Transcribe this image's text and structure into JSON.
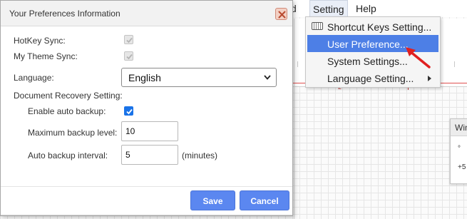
{
  "background_app": {
    "menubar": {
      "partial_item": "d",
      "setting_menu": "Setting",
      "help_menu": "Help"
    },
    "ruler_mark": "2",
    "setting_dropdown": {
      "items": [
        {
          "label": "Shortcut Keys Setting...",
          "icon": "keyboard-icon"
        },
        {
          "label": "User Preference...",
          "selected": true
        },
        {
          "label": "System Settings..."
        },
        {
          "label": "Language Setting...",
          "submenu": true
        }
      ]
    },
    "floating_panel": {
      "title": "Win",
      "icon_labels": [
        "°",
        "+5"
      ]
    },
    "annotation_color": "#e02020"
  },
  "dialog": {
    "title": "Your Preferences Information",
    "hotkey_sync": {
      "label": "HotKey Sync:",
      "checked": true,
      "disabled": true
    },
    "theme_sync": {
      "label": "My Theme Sync:",
      "checked": true,
      "disabled": true
    },
    "language": {
      "label": "Language:",
      "value": "English"
    },
    "recovery": {
      "section_label": "Document Recovery Setting:",
      "auto_backup": {
        "label": "Enable auto backup:",
        "checked": true
      },
      "max_level": {
        "label": "Maximum backup level:",
        "value": "10"
      },
      "interval": {
        "label": "Auto backup interval:",
        "value": "5",
        "unit": "(minutes)"
      }
    },
    "save_label": "Save",
    "cancel_label": "Cancel",
    "accent_color": "#5b87f0"
  }
}
